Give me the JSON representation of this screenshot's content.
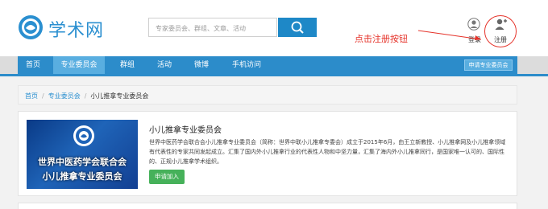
{
  "header": {
    "site_name": "学术网",
    "search_placeholder": "专家委员会、群组、文章、活动",
    "login_label": "登录",
    "register_label": "注册",
    "annotation": "点击注册按钮"
  },
  "nav": {
    "items": [
      "首页",
      "专业委员会",
      "群组",
      "活动",
      "微博",
      "手机访问"
    ],
    "active_index": 1,
    "apply_label": "申请专业委员会"
  },
  "breadcrumb": [
    "首页",
    "专业委员会",
    "小儿推拿专业委员会"
  ],
  "committee": {
    "banner_line1": "世界中医药学会联合会",
    "banner_line2": "小儿推拿专业委员会",
    "title": "小儿推拿专业委员会",
    "description": "世界中医药学会联合会小儿推拿专业委员会（简称：世界中联小儿推拿专委会）成立于2015年6月，由王立新教授、小儿推拿网及小儿推拿领域有代表性的专家共同发起成立。汇集了国内外小儿推拿行业的代表性人物和中坚力量，汇集了海内外小儿推拿同行，是国家唯一认可的、国际性的、正规小儿推拿学术组织。",
    "join_label": "申请加入"
  },
  "colors": {
    "brand_blue": "#2c8cca",
    "annotation_red": "#e5332a",
    "join_green": "#46b15a"
  }
}
